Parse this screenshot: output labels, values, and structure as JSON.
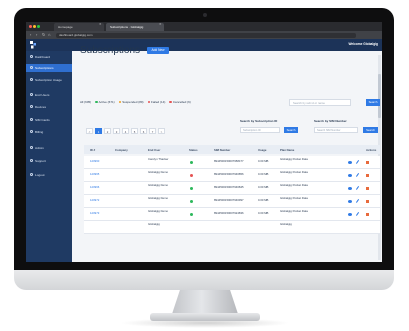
{
  "browser": {
    "tabs": [
      {
        "title": "Homepage",
        "active": false
      },
      {
        "title": "Subscriptions · Globalgig",
        "active": true
      }
    ],
    "url": "dashboard.globalgig.com"
  },
  "app": {
    "welcome": "Welcome Globalgig"
  },
  "sidebar": {
    "items": [
      {
        "label": "Dashboard",
        "icon": "dashboard-icon",
        "active": false
      },
      {
        "label": "Subscriptions",
        "icon": "list-icon",
        "active": true
      },
      {
        "label": "Subscription Usage",
        "icon": "clock-icon",
        "active": false
      },
      {
        "label": "End Users",
        "icon": "users-icon",
        "active": false
      },
      {
        "label": "Devices",
        "icon": "device-icon",
        "active": false
      },
      {
        "label": "SIM Cards",
        "icon": "sim-icon",
        "active": false
      },
      {
        "label": "Billing",
        "icon": "billing-icon",
        "active": false
      },
      {
        "label": "Admin",
        "icon": "gear-icon",
        "active": false
      },
      {
        "label": "Support",
        "icon": "support-icon",
        "active": false
      },
      {
        "label": "Logout",
        "icon": "logout-icon",
        "active": false
      }
    ]
  },
  "main": {
    "title": "Subscriptions",
    "add_label": "Add New",
    "filters": [
      {
        "label": "All (605)",
        "color": ""
      },
      {
        "label": "Active (671)",
        "color": "#2eb85c"
      },
      {
        "label": "Suspended (89)",
        "color": "#f0a020"
      },
      {
        "label": "Failed (14)",
        "color": "#e55353"
      },
      {
        "label": "Cancelled (6)",
        "color": "#e55353"
      }
    ],
    "search_placeholder": "Search by sub id or name",
    "search_label": "Search",
    "pagination": [
      "<",
      "1",
      "2",
      "3",
      "4",
      "5",
      "6",
      "7",
      ">"
    ],
    "search_sub_id": {
      "label": "Search by Subscription ID",
      "placeholder": "Subscription ID",
      "button": "Search"
    },
    "search_sim": {
      "label": "Search by SIM Number",
      "placeholder": "Search SIM Number",
      "button": "Search"
    }
  },
  "table": {
    "headers": [
      "ID #",
      "Company",
      "End User",
      "Status",
      "SIM Number",
      "Usage",
      "Plan Name",
      "Actions"
    ],
    "rows": [
      {
        "id": "120960",
        "end_user": "Carolyn Thacker",
        "status_color": "#2eb85c",
        "sim": "8944500150007958477",
        "usage": "0.00 MB",
        "plan": "Globalgig Pocket Data"
      },
      {
        "id": "120965",
        "end_user": "Globalgig Demo",
        "status_color": "#e55353",
        "sim": "8944500150007946856",
        "usage": "0.00 MB",
        "plan": "Globalgig Pocket Data"
      },
      {
        "id": "120966",
        "end_user": "Globalgig Demo",
        "status_color": "#2eb85c",
        "sim": "8944500150007946845",
        "usage": "0.00 MB",
        "plan": "Globalgig Pocket Data"
      },
      {
        "id": "120972",
        "end_user": "Globalgig Demo",
        "status_color": "#2eb85c",
        "sim": "8944500150007946997",
        "usage": "0.00 MB",
        "plan": "Globalgig Pocket Data"
      },
      {
        "id": "120973",
        "end_user": "Globalgig Demo",
        "status_color": "#2eb85c",
        "sim": "8944500150007924836",
        "usage": "0.00 MB",
        "plan": "Globalgig Pocket Data"
      },
      {
        "id": "",
        "end_user": "Globalgig",
        "status_color": "",
        "sim": "",
        "usage": "",
        "plan": "Globalgig"
      }
    ]
  }
}
